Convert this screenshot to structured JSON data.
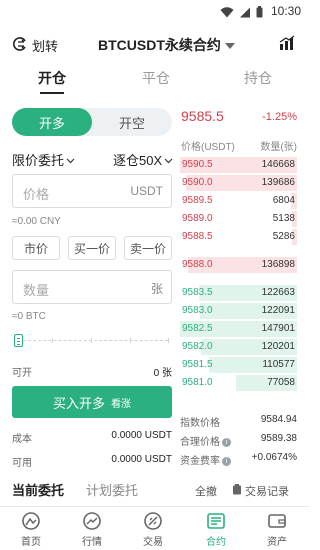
{
  "status": {
    "time": "10:30"
  },
  "header": {
    "transfer_label": "划转",
    "title": "BTCUSDT永续合约"
  },
  "tabs": [
    {
      "label": "开仓",
      "active": true
    },
    {
      "label": "平仓",
      "active": false
    },
    {
      "label": "持仓",
      "active": false
    }
  ],
  "trade": {
    "long_label": "开多",
    "short_label": "开空",
    "order_type": "限价委托",
    "leverage": "逐仓50X",
    "price_placeholder": "价格",
    "price_unit": "USDT",
    "price_cny": "≈0.00 CNY",
    "quick_prices": [
      "市价",
      "买一价",
      "卖一价"
    ],
    "qty_placeholder": "数量",
    "qty_unit": "张",
    "qty_btc": "≈0 BTC",
    "available_open_label": "可开",
    "available_open_value": "0 张",
    "buy_button": "买入开多",
    "buy_button_sub": "看涨",
    "cost_label": "成本",
    "cost_value": "0.0000 USDT",
    "available_label": "可用",
    "available_value": "0.0000 USDT"
  },
  "orderbook": {
    "last_price": "9585.5",
    "change": "-1.25%",
    "price_header": "价格(USDT)",
    "qty_header": "数量(张)",
    "asks": [
      {
        "price": "9590.5",
        "qty": "146668",
        "depth": 1.0
      },
      {
        "price": "9590.0",
        "qty": "139686",
        "depth": 0.95
      },
      {
        "price": "9589.5",
        "qty": "6804",
        "depth": 0.05
      },
      {
        "price": "9589.0",
        "qty": "5138",
        "depth": 0.04
      },
      {
        "price": "9588.5",
        "qty": "5286",
        "depth": 0.04
      },
      {
        "price": "9588.0",
        "qty": "136898",
        "depth": 0.93
      }
    ],
    "bids": [
      {
        "price": "9583.5",
        "qty": "122663",
        "depth": 0.84
      },
      {
        "price": "9583.0",
        "qty": "122091",
        "depth": 0.83
      },
      {
        "price": "9582.5",
        "qty": "147901",
        "depth": 1.0
      },
      {
        "price": "9582.0",
        "qty": "120201",
        "depth": 0.82
      },
      {
        "price": "9581.5",
        "qty": "110577",
        "depth": 0.75
      },
      {
        "price": "9581.0",
        "qty": "77058",
        "depth": 0.52
      }
    ],
    "index_label": "指数价格",
    "index_value": "9584.94",
    "fair_label": "合理价格",
    "fair_value": "9589.38",
    "funding_label": "资金费率",
    "funding_value": "+0.0674%"
  },
  "orders": {
    "current_label": "当前委托",
    "plan_label": "计划委托",
    "cancel_all": "全撤",
    "records": "交易记录"
  },
  "nav": [
    {
      "label": "首页",
      "icon": "home-icon",
      "active": false
    },
    {
      "label": "行情",
      "icon": "market-icon",
      "active": false
    },
    {
      "label": "交易",
      "icon": "trade-icon",
      "active": false
    },
    {
      "label": "合约",
      "icon": "contract-icon",
      "active": true
    },
    {
      "label": "资产",
      "icon": "wallet-icon",
      "active": false
    }
  ],
  "colors": {
    "accent": "#2bb07f",
    "red": "#d4404c"
  }
}
